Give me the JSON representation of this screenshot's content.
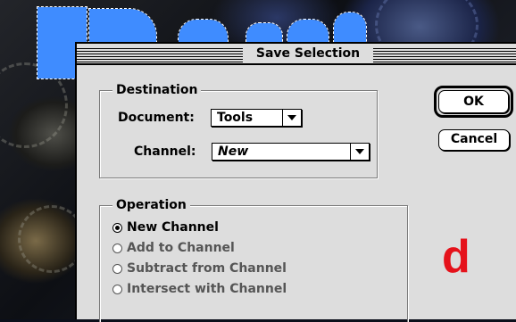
{
  "dialog": {
    "title": "Save Selection",
    "destination": {
      "label": "Destination",
      "document_label": "Document:",
      "document_value": "Tools",
      "channel_label": "Channel:",
      "channel_value": "New"
    },
    "operation": {
      "label": "Operation",
      "options": [
        {
          "label": "New Channel",
          "selected": true,
          "enabled": true
        },
        {
          "label": "Add to Channel",
          "selected": false,
          "enabled": false
        },
        {
          "label": "Subtract from Channel",
          "selected": false,
          "enabled": false
        },
        {
          "label": "Intersect with Channel",
          "selected": false,
          "enabled": false
        }
      ]
    },
    "buttons": {
      "ok": "OK",
      "cancel": "Cancel"
    }
  },
  "annotation": {
    "letter": "d",
    "color": "#e5121b"
  },
  "colors": {
    "dialog_bg": "#dddddd",
    "selection_fill": "#3f8cff"
  }
}
